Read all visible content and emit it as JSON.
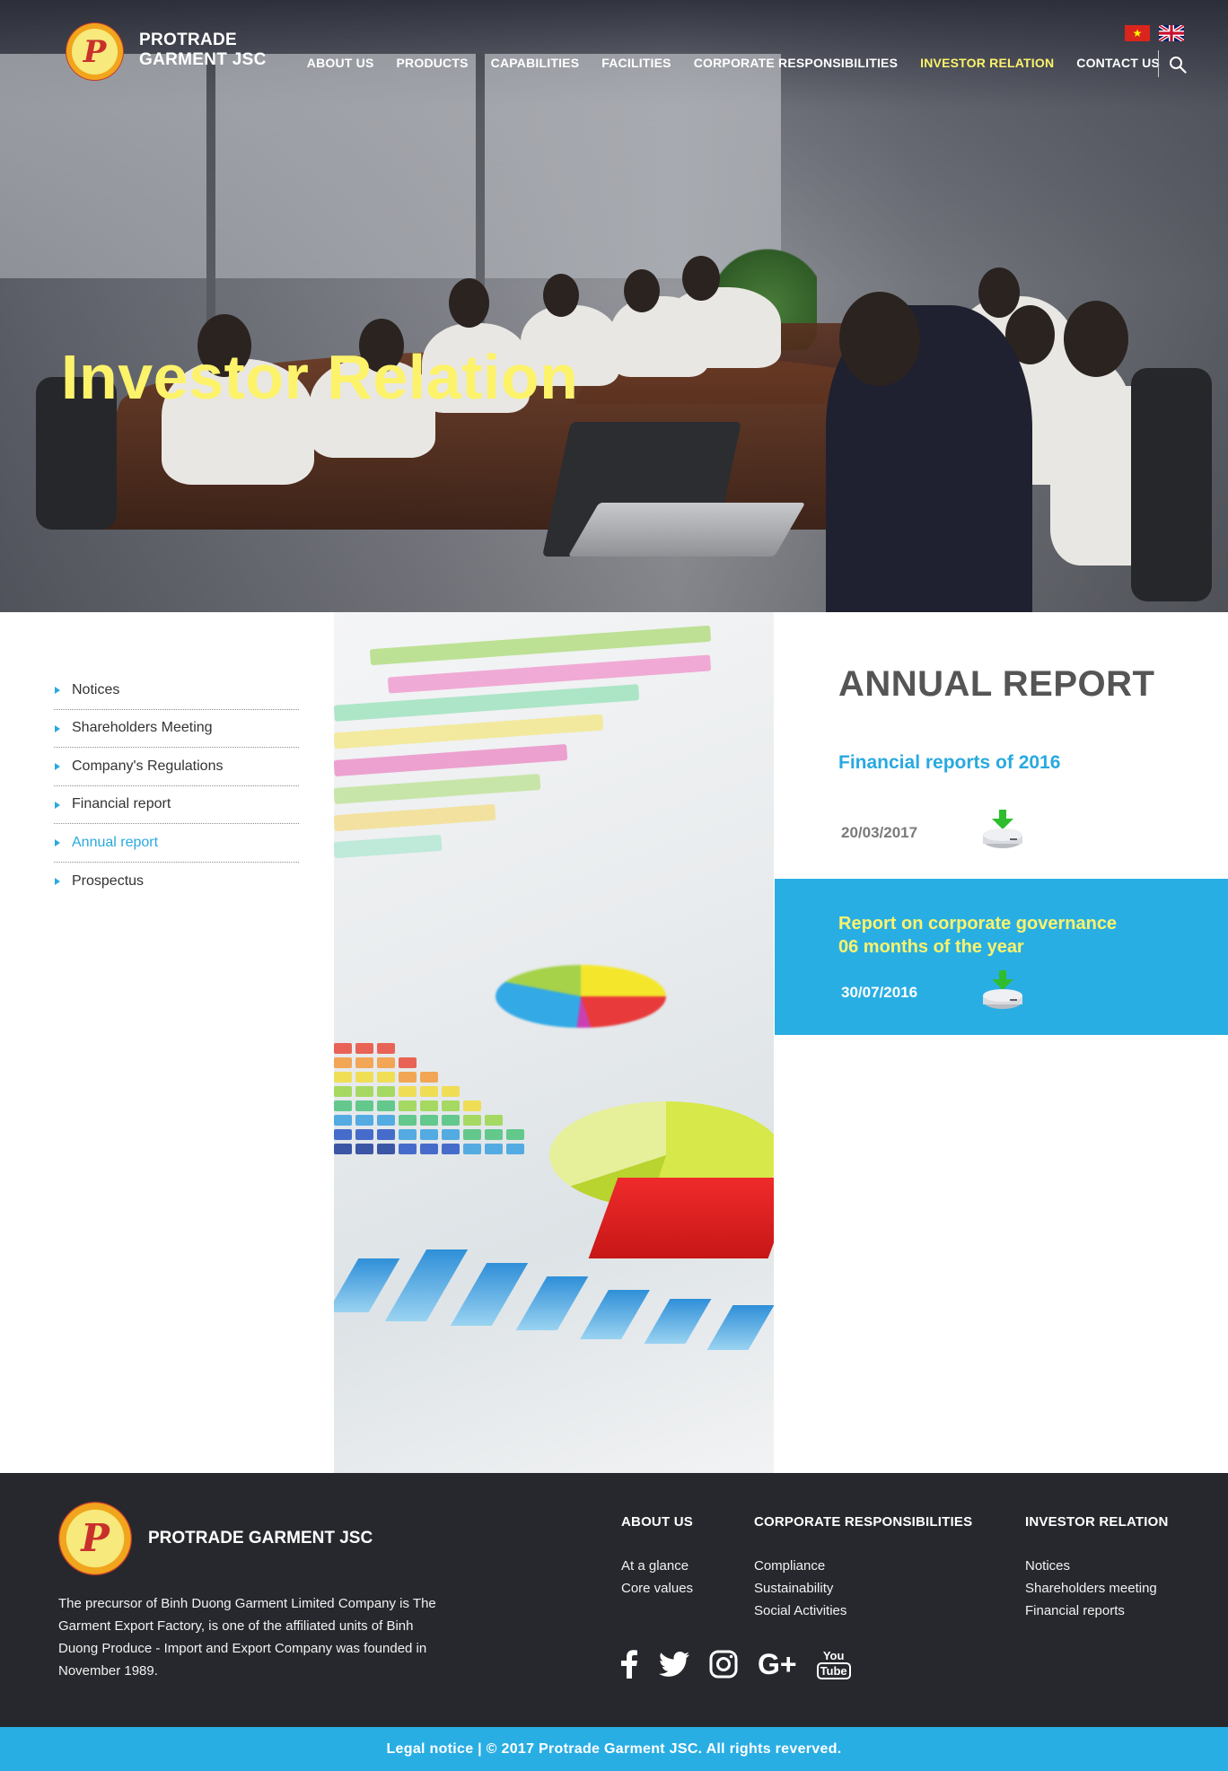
{
  "header": {
    "brand_line1": "PROTRADE",
    "brand_line2": "GARMENT JSC",
    "nav": [
      "ABOUT US",
      "PRODUCTS",
      "CAPABILITIES",
      "FACILITIES",
      "CORPORATE RESPONSIBILITIES",
      "INVESTOR RELATION",
      "CONTACT US"
    ],
    "active_nav": "INVESTOR RELATION",
    "search_icon": "search-icon",
    "languages": [
      "vn-flag-icon",
      "uk-flag-icon"
    ]
  },
  "hero": {
    "title": "Investor Relation"
  },
  "sidebar": {
    "items": [
      "Notices",
      "Shareholders Meeting",
      "Company's Regulations",
      "Financial report",
      "Annual report",
      "Prospectus"
    ],
    "active": "Annual report"
  },
  "content": {
    "heading": "ANNUAL REPORT",
    "reports": [
      {
        "title": "Financial reports of 2016",
        "date": "20/03/2017"
      },
      {
        "title_line1": "Report on corporate governance",
        "title_line2": "06 months of the year",
        "date": "30/07/2016"
      }
    ]
  },
  "footer": {
    "brand": "PROTRADE GARMENT JSC",
    "description": "The precursor of Binh Duong Garment Limited Company is The Garment Export Factory, is one of the affiliated units of Binh Duong Produce - Import and Export Company was founded in November 1989.",
    "columns": [
      {
        "heading": "ABOUT US",
        "links": [
          "At a glance",
          "Core values"
        ]
      },
      {
        "heading": "CORPORATE RESPONSIBILITIES",
        "links": [
          "Compliance",
          "Sustainability",
          "Social Activities"
        ]
      },
      {
        "heading": "INVESTOR RELATION",
        "links": [
          "Notices",
          "Shareholders meeting",
          "Financial reports"
        ]
      }
    ],
    "social": [
      "facebook-icon",
      "twitter-icon",
      "instagram-icon",
      "google-plus-icon",
      "youtube-icon"
    ],
    "youtube_line1": "You",
    "youtube_line2": "Tube",
    "google_plus_text": "G+",
    "legal": "Legal notice | © 2017 Protrade Garment JSC. All rights reverved."
  },
  "colors": {
    "accent_blue": "#29aee4",
    "accent_yellow": "#fdf36b",
    "footer_bg": "#27282d"
  }
}
